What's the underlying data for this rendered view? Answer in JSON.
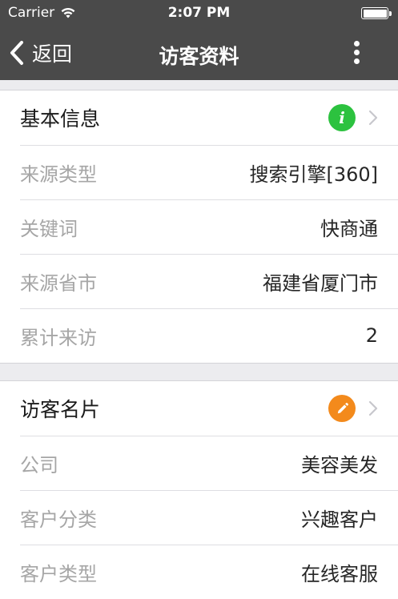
{
  "status_bar": {
    "carrier": "Carrier",
    "time": "2:07 PM"
  },
  "nav": {
    "back_label": "返回",
    "title": "访客资料"
  },
  "basic_info": {
    "header": "基本信息",
    "badge_text": "i",
    "rows": [
      {
        "label": "来源类型",
        "value": "搜索引擎[360]"
      },
      {
        "label": "关键词",
        "value": "快商通"
      },
      {
        "label": "来源省市",
        "value": "福建省厦门市"
      },
      {
        "label": "累计来访",
        "value": "2"
      }
    ]
  },
  "visitor_card": {
    "header": "访客名片",
    "rows": [
      {
        "label": "公司",
        "value": "美容美发"
      },
      {
        "label": "客户分类",
        "value": "兴趣客户"
      },
      {
        "label": "客户类型",
        "value": "在线客服"
      }
    ]
  },
  "colors": {
    "bar_background": "#4a4a4a",
    "info_badge": "#2cc23f",
    "edit_badge": "#f38a1c",
    "label_text": "#a6a6a6"
  },
  "icons": [
    "wifi-icon",
    "battery-icon",
    "back-chevron-icon",
    "more-vertical-icon",
    "info-icon",
    "pencil-icon",
    "chevron-right-icon"
  ]
}
